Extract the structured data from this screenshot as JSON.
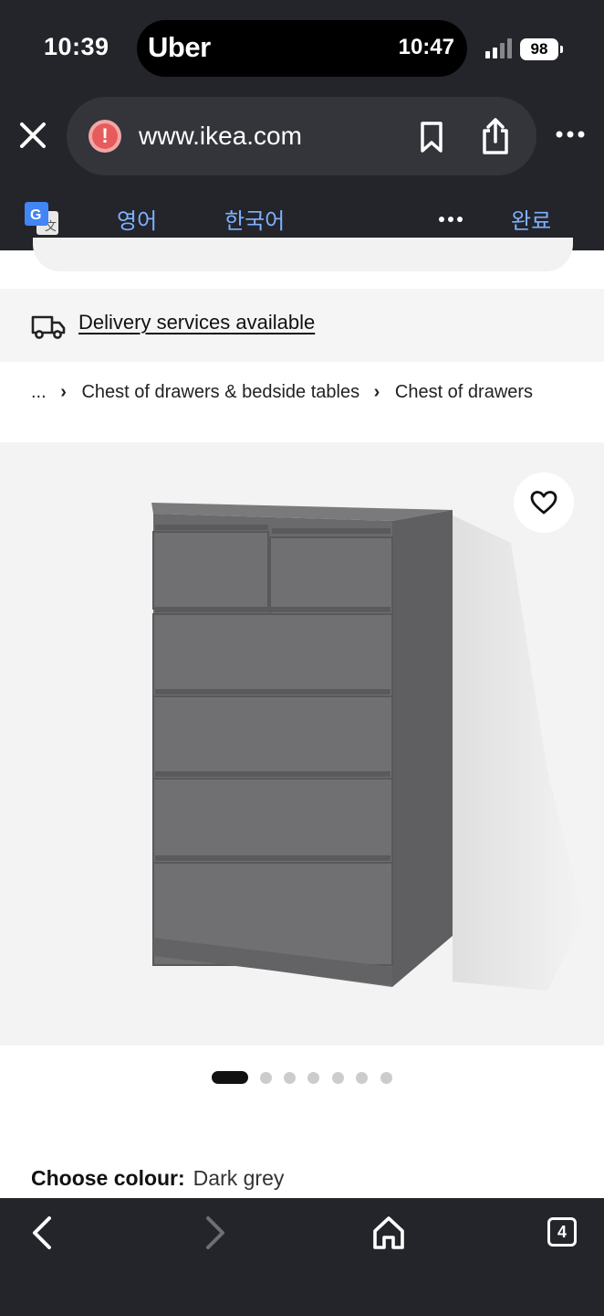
{
  "status_bar": {
    "time": "10:39",
    "island_app": "Uber",
    "island_time": "10:47",
    "battery": "98"
  },
  "browser": {
    "url": "www.ikea.com"
  },
  "translate_bar": {
    "tab_source": "영어",
    "tab_target": "한국어",
    "done": "완료"
  },
  "page": {
    "delivery_text": "Delivery services available",
    "breadcrumb": {
      "ellipsis": "...",
      "items": [
        "Chest of drawers & bedside tables",
        "Chest of drawers"
      ]
    },
    "product": {
      "color": "#6e6e70"
    },
    "carousel": {
      "count": 7,
      "active_index": 0
    },
    "colour_label": "Choose colour:",
    "colour_value": "Dark grey"
  },
  "toolbar": {
    "tab_count": "4"
  },
  "icons": [
    "close-icon",
    "warning-icon",
    "bookmark-icon",
    "share-icon",
    "more-icon",
    "translate-icon",
    "truck-icon",
    "heart-icon",
    "back-icon",
    "forward-icon",
    "home-icon",
    "tabs-icon"
  ]
}
